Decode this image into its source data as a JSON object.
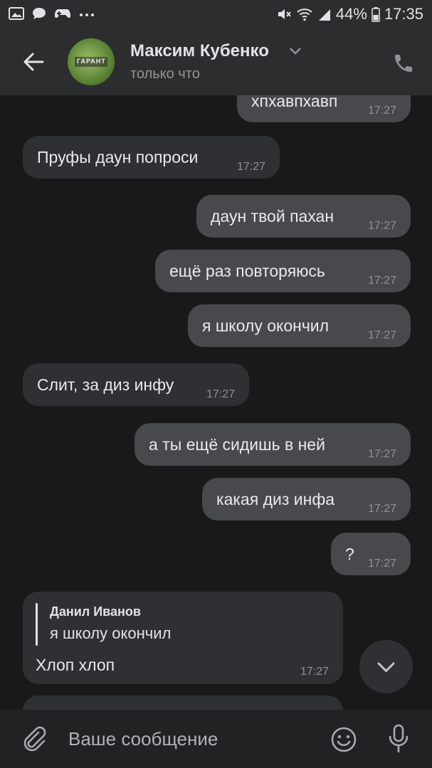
{
  "status_bar": {
    "battery": "44%",
    "time": "17:35",
    "left_icons": [
      "gallery-icon",
      "chat-bubble-icon",
      "game-controller-icon",
      "more-dots-icon"
    ],
    "right_icons": [
      "mute-icon",
      "wifi-icon",
      "signal-icon",
      "battery-icon"
    ]
  },
  "header": {
    "name": "Максим Кубенко",
    "status": "только что",
    "avatar_text": "ГАРАНТ"
  },
  "messages": [
    {
      "dir": "out",
      "text": "хпхавпхавп",
      "time": "17:27"
    },
    {
      "dir": "in",
      "text": "Пруфы даун попроси",
      "time": "17:27"
    },
    {
      "dir": "out",
      "text": "даун твой пахан",
      "time": "17:27"
    },
    {
      "dir": "out",
      "text": "ещё раз повторяюсь",
      "time": "17:27"
    },
    {
      "dir": "out",
      "text": "я школу окончил",
      "time": "17:27"
    },
    {
      "dir": "in",
      "text": "Слит, за диз инфу",
      "time": "17:27"
    },
    {
      "dir": "out",
      "text": "а ты ещё сидишь в ней",
      "time": "17:27"
    },
    {
      "dir": "out",
      "text": "какая диз инфа",
      "time": "17:27"
    },
    {
      "dir": "out",
      "text": "?",
      "time": "17:27"
    }
  ],
  "reply_message": {
    "quoted_author": "Данил Иванов",
    "quoted_text": "я школу окончил",
    "text": "Хлоп хлоп",
    "time": "17:27"
  },
  "composer": {
    "placeholder": "Ваше сообщение"
  },
  "colors": {
    "background": "#19191a",
    "bar": "#2c2d2e",
    "incoming_bubble": "#2f3034",
    "outgoing_bubble": "#47494d"
  }
}
